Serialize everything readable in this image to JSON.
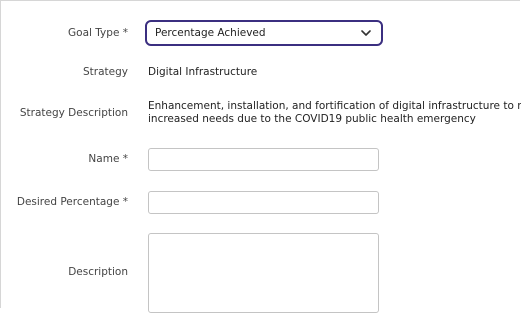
{
  "form": {
    "goal_type": {
      "label": "Goal Type *",
      "selected": "Percentage Achieved"
    },
    "strategy": {
      "label": "Strategy",
      "value": "Digital Infrastructure"
    },
    "strategy_description": {
      "label": "Strategy Description",
      "value": "Enhancement, installation, and fortification of digital infrastructure to res increased needs due to the COVID19 public health emergency",
      "line1": "Enhancement, installation, and fortification of digital infrastructure to res",
      "line2": "increased needs due to the COVID19 public health emergency"
    },
    "name": {
      "label": "Name *",
      "value": ""
    },
    "desired_percentage": {
      "label": "Desired Percentage *",
      "value": ""
    },
    "description": {
      "label": "Description",
      "value": ""
    }
  },
  "icons": {
    "select_arrow": "chevron-down-icon"
  },
  "colors": {
    "focus_border": "#3b2f80",
    "input_border": "#c4c4c4"
  }
}
